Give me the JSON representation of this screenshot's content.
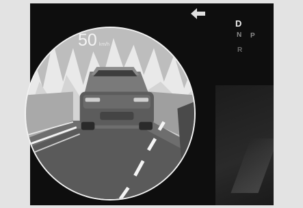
{
  "navigation": {
    "direction_icon": "left-arrow-icon"
  },
  "gear_selector": {
    "current": "D",
    "options": {
      "n": "N",
      "p": "P",
      "r": "R"
    }
  },
  "speedometer": {
    "value": "50",
    "unit": "km/h"
  },
  "scene": {
    "description_icon": "lead-vehicle-icon"
  }
}
